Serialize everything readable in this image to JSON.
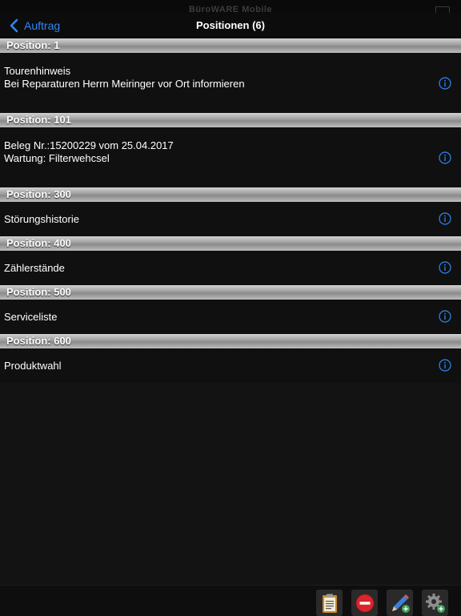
{
  "statusbar": {
    "ghost_title": "BüroWARE Mobile",
    "folder_icon": "folder-icon"
  },
  "navbar": {
    "back_label": "Auftrag",
    "title": "Positionen (6)",
    "accent_color": "#2d86f5"
  },
  "positions": [
    {
      "header": "Position: 1",
      "lines": [
        "Tourenhinweis",
        "Bei Reparaturen Herrn Meiringer vor Ort informieren"
      ],
      "info_icon": "info-icon"
    },
    {
      "header": "Position: 101",
      "lines": [
        "Beleg Nr.:15200229 vom 25.04.2017",
        "Wartung: Filterwehcsel"
      ],
      "info_icon": "info-icon"
    },
    {
      "header": "Position: 300",
      "lines": [
        "Störungshistorie"
      ],
      "info_icon": "info-icon"
    },
    {
      "header": "Position: 400",
      "lines": [
        "Zählerstände"
      ],
      "info_icon": "info-icon"
    },
    {
      "header": "Position: 500",
      "lines": [
        "Serviceliste"
      ],
      "info_icon": "info-icon"
    },
    {
      "header": "Position: 600",
      "lines": [
        "Produktwahl"
      ],
      "info_icon": "info-icon"
    }
  ],
  "toolbar": {
    "buttons": [
      {
        "icon": "clipboard-icon"
      },
      {
        "icon": "remove-icon"
      },
      {
        "icon": "edit-add-icon"
      },
      {
        "icon": "settings-add-icon"
      }
    ]
  }
}
